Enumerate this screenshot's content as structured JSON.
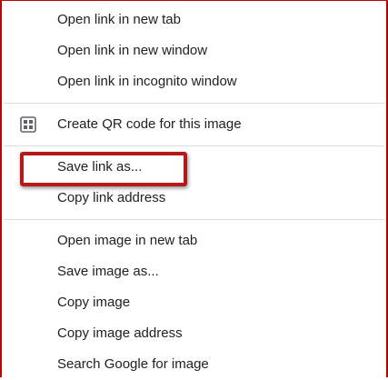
{
  "menu": {
    "group1": [
      {
        "label": "Open link in new tab"
      },
      {
        "label": "Open link in new window"
      },
      {
        "label": "Open link in incognito window"
      }
    ],
    "qr": {
      "label": "Create QR code for this image",
      "icon": "qr-code-icon"
    },
    "group3": [
      {
        "label": "Save link as..."
      },
      {
        "label": "Copy link address"
      }
    ],
    "group4": [
      {
        "label": "Open image in new tab"
      },
      {
        "label": "Save image as..."
      },
      {
        "label": "Copy image"
      },
      {
        "label": "Copy image address"
      },
      {
        "label": "Search Google for image"
      }
    ]
  },
  "colors": {
    "frame_border": "#c00000",
    "highlight_box": "#b51a1a",
    "separator": "#dadce0",
    "text": "#202124"
  }
}
